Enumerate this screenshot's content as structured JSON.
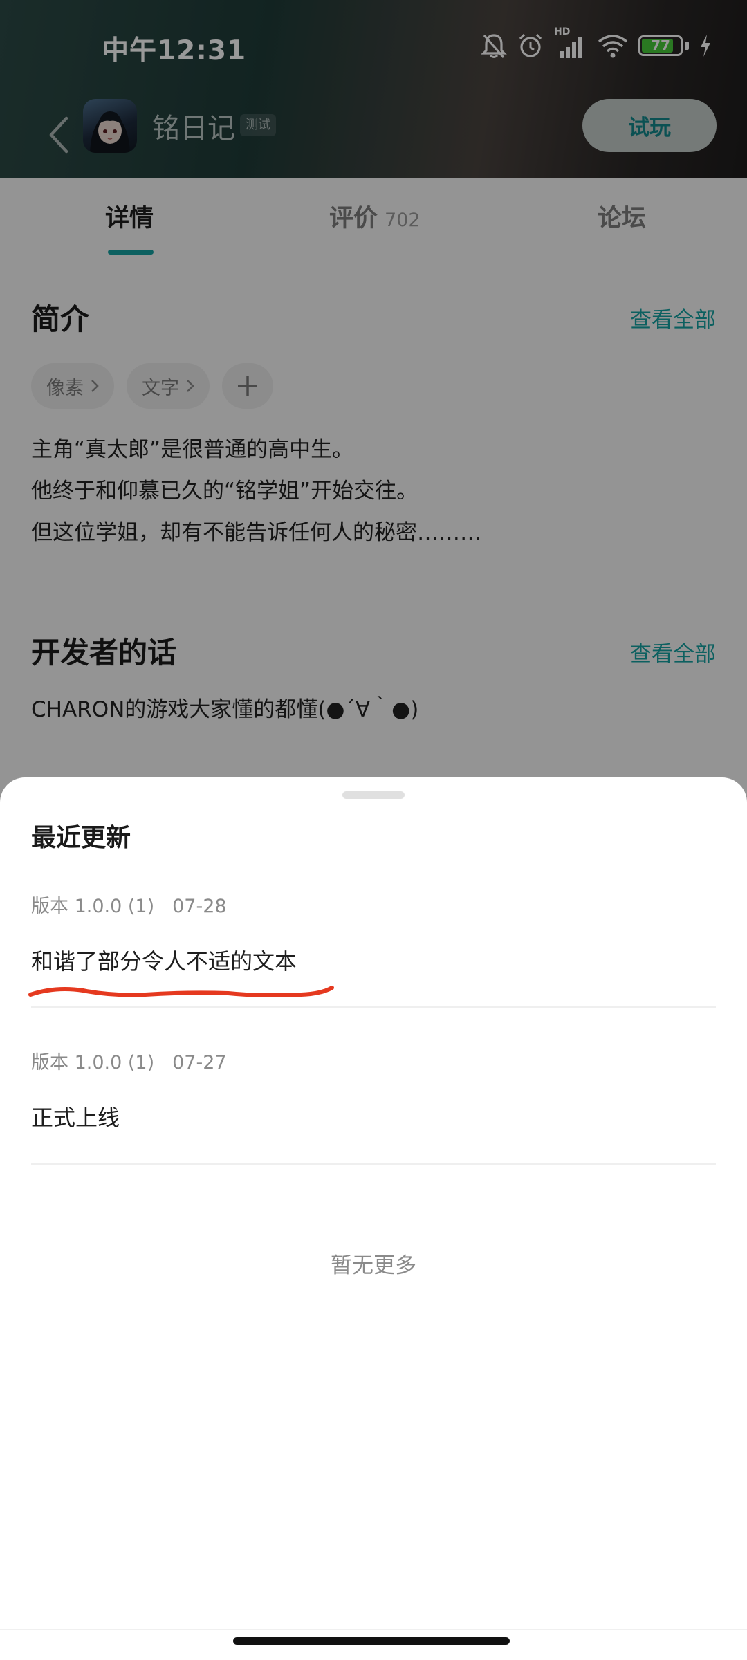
{
  "status_bar": {
    "time": "中午12:31",
    "battery_level": "77",
    "battery_fraction": 0.77,
    "icons": [
      "bell-muted-icon",
      "alarm-icon",
      "signal-icon",
      "wifi-icon",
      "battery-icon",
      "charging-icon"
    ],
    "signal_label": "HD"
  },
  "app_bar": {
    "game_title": "铭日记",
    "badge": "测试",
    "try_button": "试玩"
  },
  "tabs": [
    {
      "label": "详情"
    },
    {
      "label": "评价",
      "count": "702"
    },
    {
      "label": "论坛"
    }
  ],
  "intro": {
    "title": "简介",
    "see_all": "查看全部",
    "tags": [
      "像素",
      "文字"
    ],
    "lines": [
      "主角“真太郎”是很普通的高中生。",
      "他终于和仰慕已久的“铭学姐”开始交往。",
      "但这位学姐，却有不能告诉任何人的秘密………"
    ]
  },
  "developer": {
    "title": "开发者的话",
    "see_all": "查看全部",
    "text": "CHARON的游戏大家懂的都懂(●´∀｀●)"
  },
  "sheet": {
    "title": "最近更新",
    "updates": [
      {
        "version": "版本 1.0.0 (1)",
        "date": "07-28",
        "text": "和谐了部分令人不适的文本"
      },
      {
        "version": "版本 1.0.0 (1)",
        "date": "07-27",
        "text": "正式上线"
      }
    ],
    "no_more": "暂无更多"
  },
  "colors": {
    "accent": "#14a0a0",
    "annotation": "#e5391f"
  }
}
